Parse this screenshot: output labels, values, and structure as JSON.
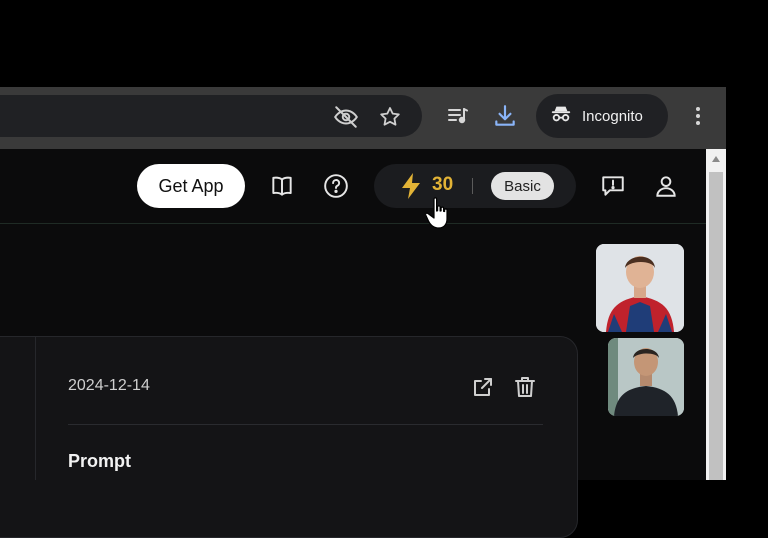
{
  "browser": {
    "incognito_label": "Incognito",
    "icons": [
      "eye-off-icon",
      "star-icon",
      "media-queue-icon",
      "download-icon",
      "incognito-icon",
      "more-vert-icon"
    ]
  },
  "header": {
    "get_app_label": "Get App",
    "credits": "30",
    "plan_badge": "Basic",
    "icons": [
      "book-icon",
      "help-icon",
      "lightning-icon",
      "feedback-icon",
      "user-icon"
    ]
  },
  "card": {
    "date": "2024-12-14",
    "prompt_label": "Prompt",
    "icons": [
      "open-external-icon",
      "trash-icon"
    ]
  },
  "colors": {
    "accent": "#e2b336",
    "background": "#0b0b0c",
    "chrome": "#3a3a3a"
  }
}
